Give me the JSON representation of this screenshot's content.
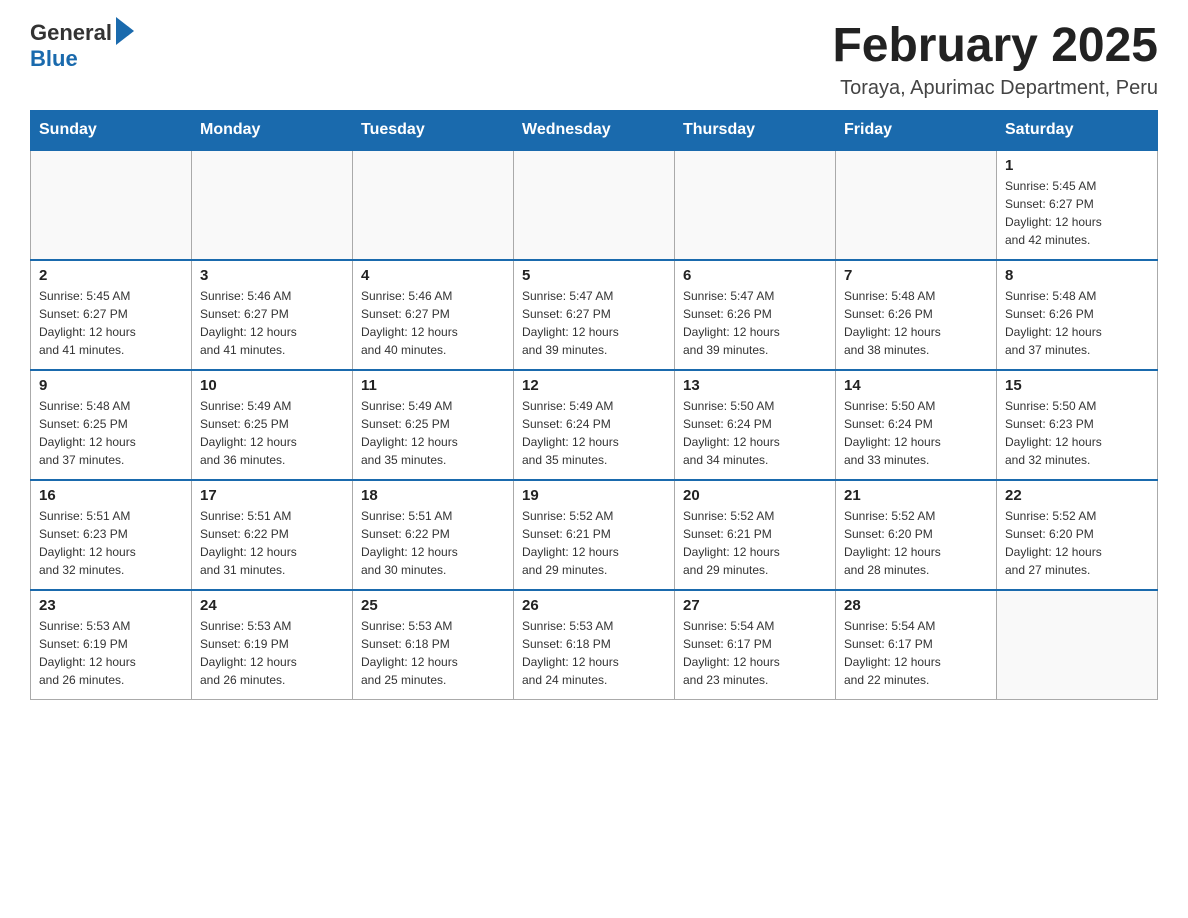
{
  "header": {
    "logo_general": "General",
    "logo_blue": "Blue",
    "month_title": "February 2025",
    "location": "Toraya, Apurimac Department, Peru"
  },
  "weekdays": [
    "Sunday",
    "Monday",
    "Tuesday",
    "Wednesday",
    "Thursday",
    "Friday",
    "Saturday"
  ],
  "weeks": [
    [
      {
        "day": "",
        "info": ""
      },
      {
        "day": "",
        "info": ""
      },
      {
        "day": "",
        "info": ""
      },
      {
        "day": "",
        "info": ""
      },
      {
        "day": "",
        "info": ""
      },
      {
        "day": "",
        "info": ""
      },
      {
        "day": "1",
        "info": "Sunrise: 5:45 AM\nSunset: 6:27 PM\nDaylight: 12 hours\nand 42 minutes."
      }
    ],
    [
      {
        "day": "2",
        "info": "Sunrise: 5:45 AM\nSunset: 6:27 PM\nDaylight: 12 hours\nand 41 minutes."
      },
      {
        "day": "3",
        "info": "Sunrise: 5:46 AM\nSunset: 6:27 PM\nDaylight: 12 hours\nand 41 minutes."
      },
      {
        "day": "4",
        "info": "Sunrise: 5:46 AM\nSunset: 6:27 PM\nDaylight: 12 hours\nand 40 minutes."
      },
      {
        "day": "5",
        "info": "Sunrise: 5:47 AM\nSunset: 6:27 PM\nDaylight: 12 hours\nand 39 minutes."
      },
      {
        "day": "6",
        "info": "Sunrise: 5:47 AM\nSunset: 6:26 PM\nDaylight: 12 hours\nand 39 minutes."
      },
      {
        "day": "7",
        "info": "Sunrise: 5:48 AM\nSunset: 6:26 PM\nDaylight: 12 hours\nand 38 minutes."
      },
      {
        "day": "8",
        "info": "Sunrise: 5:48 AM\nSunset: 6:26 PM\nDaylight: 12 hours\nand 37 minutes."
      }
    ],
    [
      {
        "day": "9",
        "info": "Sunrise: 5:48 AM\nSunset: 6:25 PM\nDaylight: 12 hours\nand 37 minutes."
      },
      {
        "day": "10",
        "info": "Sunrise: 5:49 AM\nSunset: 6:25 PM\nDaylight: 12 hours\nand 36 minutes."
      },
      {
        "day": "11",
        "info": "Sunrise: 5:49 AM\nSunset: 6:25 PM\nDaylight: 12 hours\nand 35 minutes."
      },
      {
        "day": "12",
        "info": "Sunrise: 5:49 AM\nSunset: 6:24 PM\nDaylight: 12 hours\nand 35 minutes."
      },
      {
        "day": "13",
        "info": "Sunrise: 5:50 AM\nSunset: 6:24 PM\nDaylight: 12 hours\nand 34 minutes."
      },
      {
        "day": "14",
        "info": "Sunrise: 5:50 AM\nSunset: 6:24 PM\nDaylight: 12 hours\nand 33 minutes."
      },
      {
        "day": "15",
        "info": "Sunrise: 5:50 AM\nSunset: 6:23 PM\nDaylight: 12 hours\nand 32 minutes."
      }
    ],
    [
      {
        "day": "16",
        "info": "Sunrise: 5:51 AM\nSunset: 6:23 PM\nDaylight: 12 hours\nand 32 minutes."
      },
      {
        "day": "17",
        "info": "Sunrise: 5:51 AM\nSunset: 6:22 PM\nDaylight: 12 hours\nand 31 minutes."
      },
      {
        "day": "18",
        "info": "Sunrise: 5:51 AM\nSunset: 6:22 PM\nDaylight: 12 hours\nand 30 minutes."
      },
      {
        "day": "19",
        "info": "Sunrise: 5:52 AM\nSunset: 6:21 PM\nDaylight: 12 hours\nand 29 minutes."
      },
      {
        "day": "20",
        "info": "Sunrise: 5:52 AM\nSunset: 6:21 PM\nDaylight: 12 hours\nand 29 minutes."
      },
      {
        "day": "21",
        "info": "Sunrise: 5:52 AM\nSunset: 6:20 PM\nDaylight: 12 hours\nand 28 minutes."
      },
      {
        "day": "22",
        "info": "Sunrise: 5:52 AM\nSunset: 6:20 PM\nDaylight: 12 hours\nand 27 minutes."
      }
    ],
    [
      {
        "day": "23",
        "info": "Sunrise: 5:53 AM\nSunset: 6:19 PM\nDaylight: 12 hours\nand 26 minutes."
      },
      {
        "day": "24",
        "info": "Sunrise: 5:53 AM\nSunset: 6:19 PM\nDaylight: 12 hours\nand 26 minutes."
      },
      {
        "day": "25",
        "info": "Sunrise: 5:53 AM\nSunset: 6:18 PM\nDaylight: 12 hours\nand 25 minutes."
      },
      {
        "day": "26",
        "info": "Sunrise: 5:53 AM\nSunset: 6:18 PM\nDaylight: 12 hours\nand 24 minutes."
      },
      {
        "day": "27",
        "info": "Sunrise: 5:54 AM\nSunset: 6:17 PM\nDaylight: 12 hours\nand 23 minutes."
      },
      {
        "day": "28",
        "info": "Sunrise: 5:54 AM\nSunset: 6:17 PM\nDaylight: 12 hours\nand 22 minutes."
      },
      {
        "day": "",
        "info": ""
      }
    ]
  ]
}
